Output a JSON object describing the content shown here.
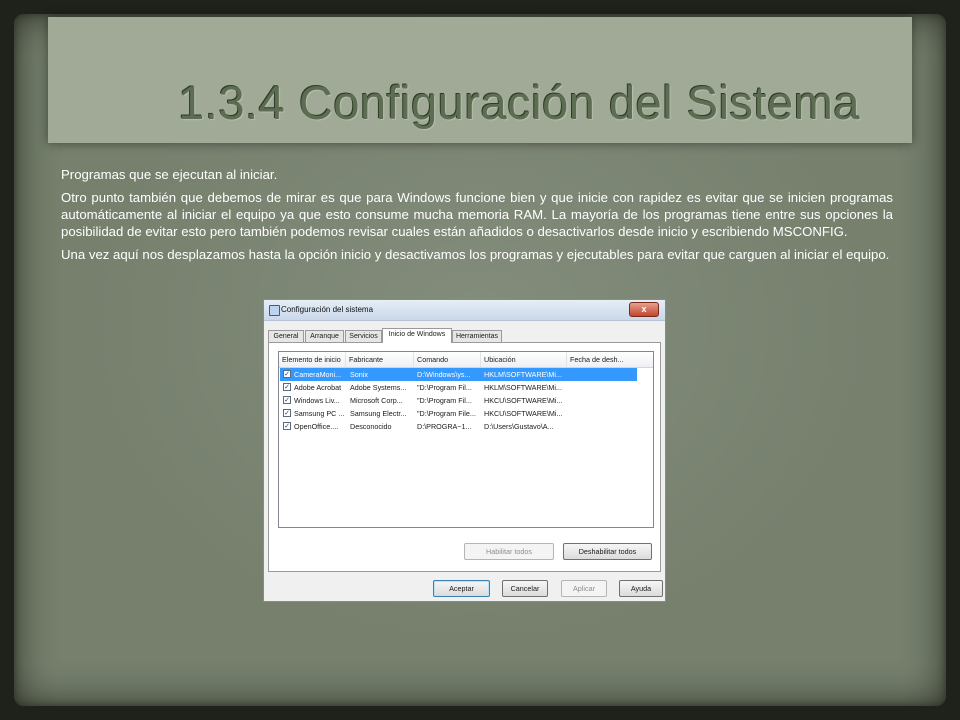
{
  "slide": {
    "title": "1.3.4 Configuración del Sistema",
    "paragraphs": [
      "Programas que se ejecutan al iniciar.",
      "Otro punto también que debemos de mirar es que para Windows funcione bien y que inicie con rapidez es evitar que se inicien programas automáticamente al iniciar el equipo ya que esto consume  mucha memoria RAM. La mayoría de los programas tiene entre sus opciones la posibilidad de evitar esto pero también podemos revisar cuales están añadidos o desactivarlos desde inicio y escribiendo MSCONFIG.",
      "Una vez aquí nos desplazamos hasta la opción inicio y desactivamos los programas y ejecutables para evitar que carguen al iniciar el equipo."
    ]
  },
  "dialog": {
    "title": "Configuración del sistema",
    "close_label": "x",
    "tabs": [
      {
        "label": "General",
        "active": false
      },
      {
        "label": "Arranque",
        "active": false
      },
      {
        "label": "Servicios",
        "active": false
      },
      {
        "label": "Inicio de Windows",
        "active": true
      },
      {
        "label": "Herramientas",
        "active": false
      }
    ],
    "columns": [
      "Elemento de inicio",
      "Fabricante",
      "Comando",
      "Ubicación",
      "Fecha de desh..."
    ],
    "rows": [
      {
        "checked": true,
        "selected": true,
        "cells": [
          "CameraMoni...",
          "Sonix",
          "D:\\Windows\\ys...",
          "HKLM\\SOFTWARE\\Mi...",
          ""
        ]
      },
      {
        "checked": true,
        "selected": false,
        "cells": [
          "Adobe Acrobat",
          "Adobe Systems...",
          "\"D:\\Program Fil...",
          "HKLM\\SOFTWARE\\Mi...",
          ""
        ]
      },
      {
        "checked": true,
        "selected": false,
        "cells": [
          "Windows Liv...",
          "Microsoft Corp...",
          "\"D:\\Program Fil...",
          "HKCU\\SOFTWARE\\Mi...",
          ""
        ]
      },
      {
        "checked": true,
        "selected": false,
        "cells": [
          "Samsung PC ...",
          "Samsung Electr...",
          "\"D:\\Program File...",
          "HKCU\\SOFTWARE\\Mi...",
          ""
        ]
      },
      {
        "checked": true,
        "selected": false,
        "cells": [
          "OpenOffice....",
          "Desconocido",
          "D:\\PROGRA~1...",
          "D:\\Users\\Gustavo\\A...",
          ""
        ]
      }
    ],
    "buttons": {
      "enable_all": "Habilitar todos",
      "disable_all": "Deshabilitar todos",
      "ok": "Aceptar",
      "cancel": "Cancelar",
      "apply": "Aplicar",
      "help": "Ayuda"
    }
  }
}
